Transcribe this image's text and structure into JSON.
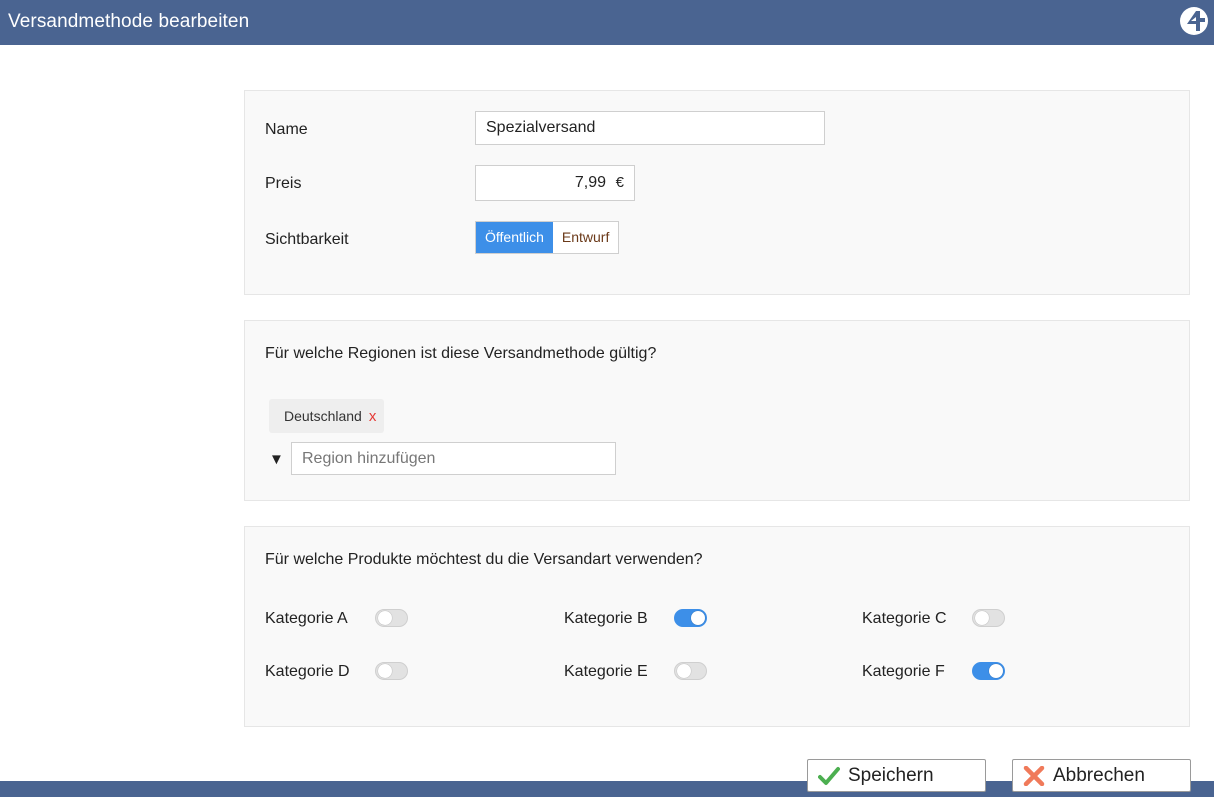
{
  "window": {
    "title": "Versandmethode bearbeiten"
  },
  "colors": {
    "header": "#4a6491",
    "accent": "#3d8fe8",
    "save_icon": "#4caf50",
    "cancel_icon": "#f07a5a",
    "remove": "#e53935"
  },
  "general": {
    "name_label": "Name",
    "name_value": "Spezialversand",
    "price_label": "Preis",
    "price_value": "7,99",
    "price_unit": "€",
    "visibility_label": "Sichtbarkeit",
    "visibility_options": [
      "Öffentlich",
      "Entwurf"
    ],
    "visibility_selected": "Öffentlich"
  },
  "regions": {
    "question": "Für welche Regionen ist diese Versandmethode gültig?",
    "chips": [
      {
        "label": "Deutschland",
        "remove": "x"
      }
    ],
    "dropdown_caret": "▼",
    "add_placeholder": "Region hinzufügen"
  },
  "products": {
    "question": "Für welche Produkte möchtest du die Versandart verwenden?",
    "categories": [
      {
        "label": "Kategorie A",
        "enabled": false
      },
      {
        "label": "Kategorie B",
        "enabled": true
      },
      {
        "label": "Kategorie C",
        "enabled": false
      },
      {
        "label": "Kategorie D",
        "enabled": false
      },
      {
        "label": "Kategorie E",
        "enabled": false
      },
      {
        "label": "Kategorie F",
        "enabled": true
      }
    ]
  },
  "footer": {
    "save_label": "Speichern",
    "save_icon": "checkmark-icon",
    "cancel_label": "Abbrechen",
    "cancel_icon": "cross-icon"
  }
}
